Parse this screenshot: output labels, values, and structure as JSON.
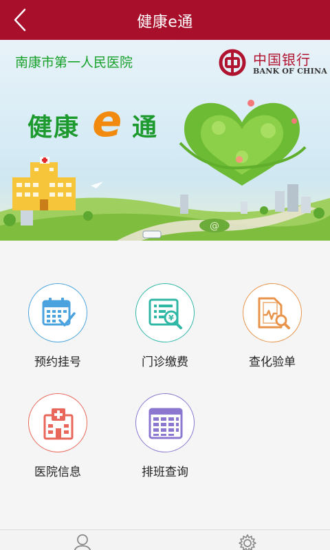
{
  "header": {
    "title": "健康e通"
  },
  "banner": {
    "hospital_name": "南康市第一人民医院",
    "bank_name_cn": "中国银行",
    "bank_name_en": "BANK OF CHINA",
    "slogan_part1": "健康",
    "slogan_part2": "e",
    "slogan_part3": "通"
  },
  "menu": {
    "items": [
      {
        "label": "预约挂号",
        "icon": "calendar-check-icon",
        "color": "#4aa3df"
      },
      {
        "label": "门诊缴费",
        "icon": "payment-search-icon",
        "color": "#2fb7a6"
      },
      {
        "label": "查化验单",
        "icon": "lab-report-search-icon",
        "color": "#e8934a"
      },
      {
        "label": "医院信息",
        "icon": "hospital-building-icon",
        "color": "#e8665a"
      },
      {
        "label": "排班查询",
        "icon": "schedule-table-icon",
        "color": "#8b76d0"
      }
    ]
  },
  "colors": {
    "header": "#a80f2b",
    "slogan_green": "#1d9a2e",
    "slogan_orange": "#f28a10"
  },
  "tabbar": {
    "icons": [
      "user-icon",
      "settings-gear-icon"
    ]
  }
}
